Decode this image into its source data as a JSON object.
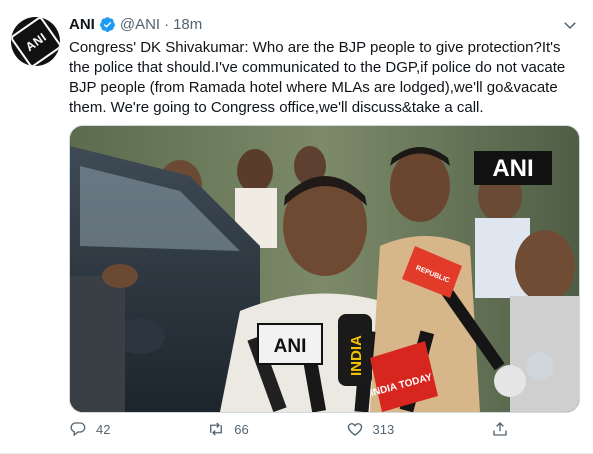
{
  "author": {
    "name": "ANI",
    "handle": "@ANI",
    "separator": "·",
    "time": "18m",
    "avatar_text": "ANI"
  },
  "tweet_text": "Congress' DK Shivakumar: Who are the BJP people to give protection?It's the police that should.I've communicated to the DGP,if police do not vacate BJP people (from Ramada hotel where MLAs are lodged),we'll go&vacate them. We're going to Congress office,we'll discuss&take a call.",
  "media": {
    "watermark": "ANI",
    "mic_labels": {
      "ani": "ANI",
      "india": "INDIA",
      "india_today": "INDIA TODAY",
      "republic": "REPUBLIC"
    }
  },
  "actions": {
    "reply_count": "42",
    "retweet_count": "66",
    "like_count": "313"
  },
  "colors": {
    "verified": "#1d9bf0",
    "muted": "#536471"
  },
  "icons": [
    "verified-badge-icon",
    "chevron-down-icon",
    "reply-icon",
    "retweet-icon",
    "like-icon",
    "share-icon"
  ]
}
